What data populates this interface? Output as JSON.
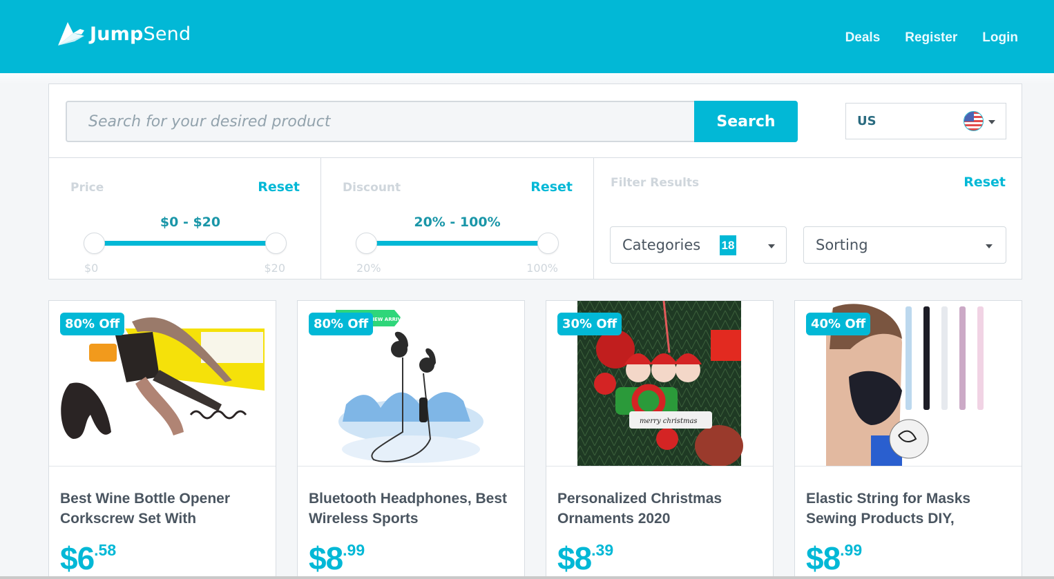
{
  "header": {
    "brand_bold": "Jump",
    "brand_light": "Send",
    "nav": [
      "Deals",
      "Register",
      "Login"
    ]
  },
  "search": {
    "placeholder": "Search for your desired product",
    "value": "",
    "button_label": "Search",
    "country": "US",
    "country_icon": "us-flag-icon"
  },
  "filters": {
    "price": {
      "label": "Price",
      "reset": "Reset",
      "range_text": "$0 - $20",
      "min_label": "$0",
      "max_label": "$20",
      "low": 0,
      "high": 20
    },
    "discount": {
      "label": "Discount",
      "reset": "Reset",
      "range_text": "20% - 100%",
      "min_label": "20%",
      "max_label": "100%",
      "low": 20,
      "high": 100
    },
    "results": {
      "label": "Filter Results",
      "reset": "Reset",
      "categories_label": "Categories",
      "categories_count": "18",
      "sorting_label": "Sorting"
    }
  },
  "products": [
    {
      "badge": "80% Off",
      "title": "Best Wine Bottle Opener Corkscrew Set With",
      "price_main": "$6",
      "price_cents": ".58",
      "image": "wine-opener-image"
    },
    {
      "badge": "80% Off",
      "title": "Bluetooth Headphones, Best Wireless Sports",
      "price_main": "$8",
      "price_cents": ".99",
      "image": "headphones-image",
      "ribbon": "NEW ARRIVAL"
    },
    {
      "badge": "30% Off",
      "title": "Personalized Christmas Ornaments 2020",
      "price_main": "$8",
      "price_cents": ".39",
      "image": "christmas-ornament-image"
    },
    {
      "badge": "40% Off",
      "title": "Elastic String for Masks Sewing Products DIY,",
      "price_main": "$8",
      "price_cents": ".99",
      "image": "mask-elastic-image"
    }
  ],
  "colors": {
    "brand": "#02b8d6",
    "text": "#4a5560",
    "muted": "#cfd6dc"
  }
}
